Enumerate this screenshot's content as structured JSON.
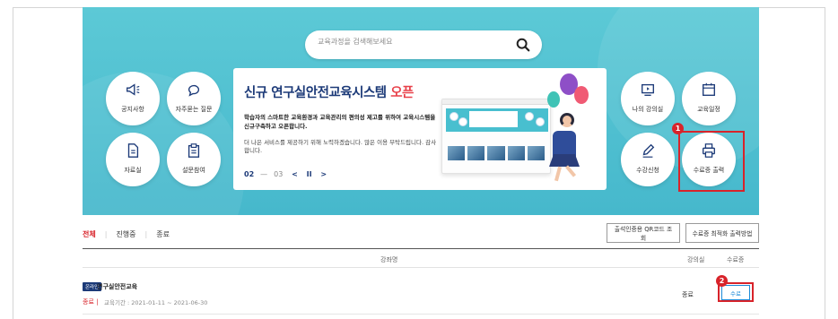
{
  "search": {
    "placeholder": "교육과정을 검색해보세요"
  },
  "quick_links_left": [
    {
      "label": "공지사항",
      "icon": "megaphone-icon"
    },
    {
      "label": "자주묻는 질문",
      "icon": "speech-bubble-icon"
    },
    {
      "label": "자료실",
      "icon": "document-icon"
    },
    {
      "label": "설문참여",
      "icon": "clipboard-icon"
    }
  ],
  "quick_links_right": [
    {
      "label": "나의 강의실",
      "icon": "play-screen-icon"
    },
    {
      "label": "교육일정",
      "icon": "calendar-icon"
    },
    {
      "label": "수강신청",
      "icon": "pencil-icon"
    },
    {
      "label": "수료증 출력",
      "icon": "printer-icon"
    }
  ],
  "banner": {
    "title_main": "신규 연구실안전교육시스템 ",
    "title_accent": "오픈",
    "desc_bold": "학습자의 스마트한 교육환경과 교육관리의 편의성 제고를 위하여 교육시스템을 신규구축하고 오픈합니다.",
    "desc_normal": "더 나은 서비스를 제공하기 위해 노력하겠습니다. 많은 이용 부탁드립니다. 감사합니다.",
    "pager_current": "02",
    "pager_sep": "—",
    "pager_total": "03",
    "prev": "<",
    "pause": "II",
    "next": ">"
  },
  "markers": {
    "first": "1",
    "second": "2"
  },
  "filters": [
    "전체",
    "진행중",
    "종료"
  ],
  "buttons": {
    "qr_lookup": "출석인증용 QR코드 조회",
    "print_guide": "수료증 최적화 출력방법"
  },
  "table": {
    "headers": {
      "course": "강좌명",
      "room": "강의실",
      "certificate": "수료증"
    },
    "rows": [
      {
        "badge": "온라인",
        "course": "연구실안전교육",
        "status": "종료",
        "period": "교육기간 : 2021-01-11 ~ 2021-06-30",
        "room_status": "종료",
        "cert_button": "수료"
      }
    ]
  },
  "colors": {
    "hero": "#4fbfd0",
    "navy": "#1c3a78",
    "red": "#d8232a",
    "link_blue": "#1c8ad8"
  }
}
